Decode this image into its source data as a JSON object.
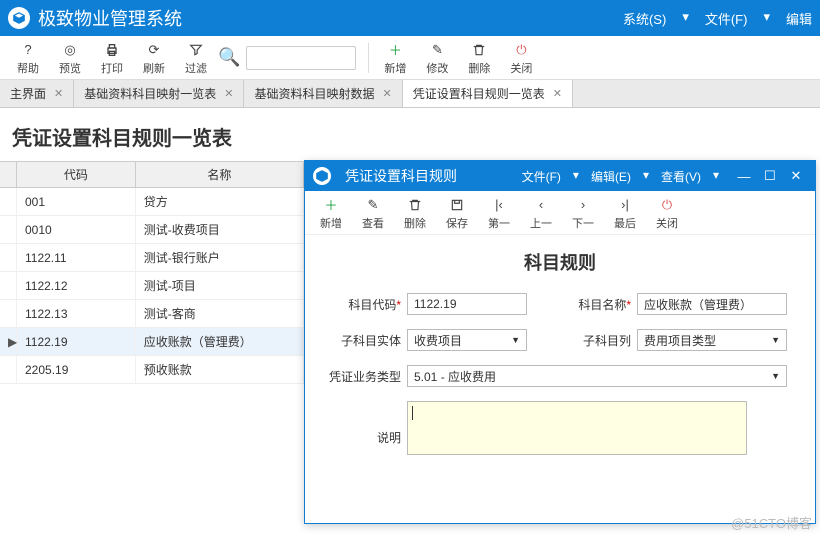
{
  "app": {
    "title": "极致物业管理系统"
  },
  "main_menu": {
    "system": "系统(S)",
    "file": "文件(F)",
    "edit": "编辑"
  },
  "toolbar": {
    "help": "帮助",
    "preview": "预览",
    "print": "打印",
    "refresh": "刷新",
    "filter": "过滤",
    "add": "新增",
    "modify": "修改",
    "delete": "删除",
    "close": "关闭"
  },
  "tabs": [
    {
      "label": "主界面"
    },
    {
      "label": "基础资料科目映射一览表"
    },
    {
      "label": "基础资料科目映射数据"
    },
    {
      "label": "凭证设置科目规则一览表"
    }
  ],
  "page": {
    "title": "凭证设置科目规则一览表"
  },
  "grid": {
    "headers": {
      "code": "代码",
      "name": "名称"
    },
    "rows": [
      {
        "code": "001",
        "name": "贷方"
      },
      {
        "code": "0010",
        "name": "测试-收费项目"
      },
      {
        "code": "1122.11",
        "name": "测试-银行账户"
      },
      {
        "code": "1122.12",
        "name": "测试-项目"
      },
      {
        "code": "1122.13",
        "name": "测试-客商"
      },
      {
        "code": "1122.19",
        "name": "应收账款（管理费）"
      },
      {
        "code": "2205.19",
        "name": "预收账款"
      }
    ],
    "selected_index": 5
  },
  "dialog": {
    "title": "凭证设置科目规则",
    "menu": {
      "file": "文件(F)",
      "edit": "编辑(E)",
      "view": "查看(V)"
    },
    "toolbar": {
      "add": "新增",
      "view": "查看",
      "delete": "删除",
      "save": "保存",
      "first": "第一",
      "prev": "上一",
      "next": "下一",
      "last": "最后",
      "close": "关闭"
    },
    "heading": "科目规则",
    "labels": {
      "code": "科目代码",
      "name": "科目名称",
      "sub_entity": "子科目实体",
      "sub_col": "子科目列",
      "biz_type": "凭证业务类型",
      "desc": "说明"
    },
    "values": {
      "code": "1122.19",
      "name": "应收账款（管理费）",
      "sub_entity": "收费项目",
      "sub_col": "费用项目类型",
      "biz_type": "5.01 - 应收费用",
      "desc": ""
    }
  },
  "watermark": "@51CTO博客"
}
